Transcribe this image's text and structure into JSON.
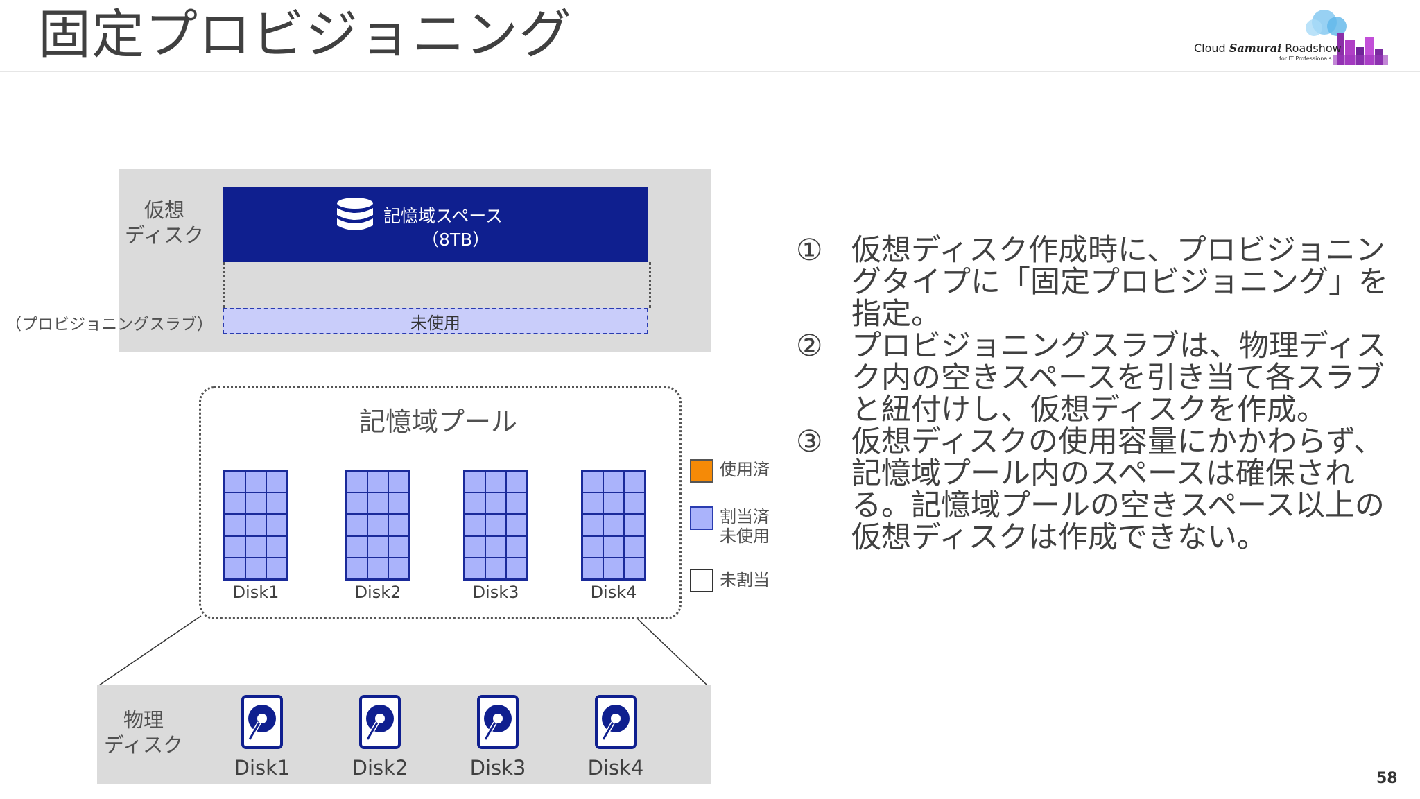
{
  "slide": {
    "title": "固定プロビジョニング",
    "page_number": "58"
  },
  "logo": {
    "cloud": "Cloud",
    "samurai": "Samurai",
    "roadshow": "Roadshow",
    "subtitle": "for IT Professionals"
  },
  "virtual_disk": {
    "label_line1": "仮想",
    "label_line2": "ディスク",
    "space_name": "記憶域スペース",
    "space_size": "（8TB）",
    "slab_text": "未使用",
    "slab_label": "（プロビジョニングスラブ）"
  },
  "pool": {
    "title": "記憶域プール",
    "disks": [
      "Disk1",
      "Disk2",
      "Disk3",
      "Disk4"
    ]
  },
  "legend": {
    "used": "使用済",
    "allocated_line1": "割当済",
    "allocated_line2": "未使用",
    "unallocated": "未割当",
    "colors": {
      "used": "#f58a07",
      "allocated": "#aab3fb",
      "unallocated": "#ffffff"
    }
  },
  "physical": {
    "label_line1": "物理",
    "label_line2": "ディスク",
    "disks": [
      "Disk1",
      "Disk2",
      "Disk3",
      "Disk4"
    ]
  },
  "steps": [
    {
      "num": "①",
      "text": "仮想ディスク作成時に、プロビジョニングタイプに「固定プロビジョニング」を指定。"
    },
    {
      "num": "②",
      "text": "プロビジョニングスラブは、物理ディスク内の空きスペースを引き当て各スラブと紐付けし、仮想ディスクを作成。"
    },
    {
      "num": "③",
      "text": "仮想ディスクの使用容量にかかわらず、記憶域プール内のスペースは確保される。記憶域プールの空きスペース以上の仮想ディスクは作成できない。"
    }
  ],
  "colors": {
    "accent_blue": "#0f1f8f",
    "slab_fill": "#c9cdfa",
    "panel_gray": "#dbdbdb"
  }
}
